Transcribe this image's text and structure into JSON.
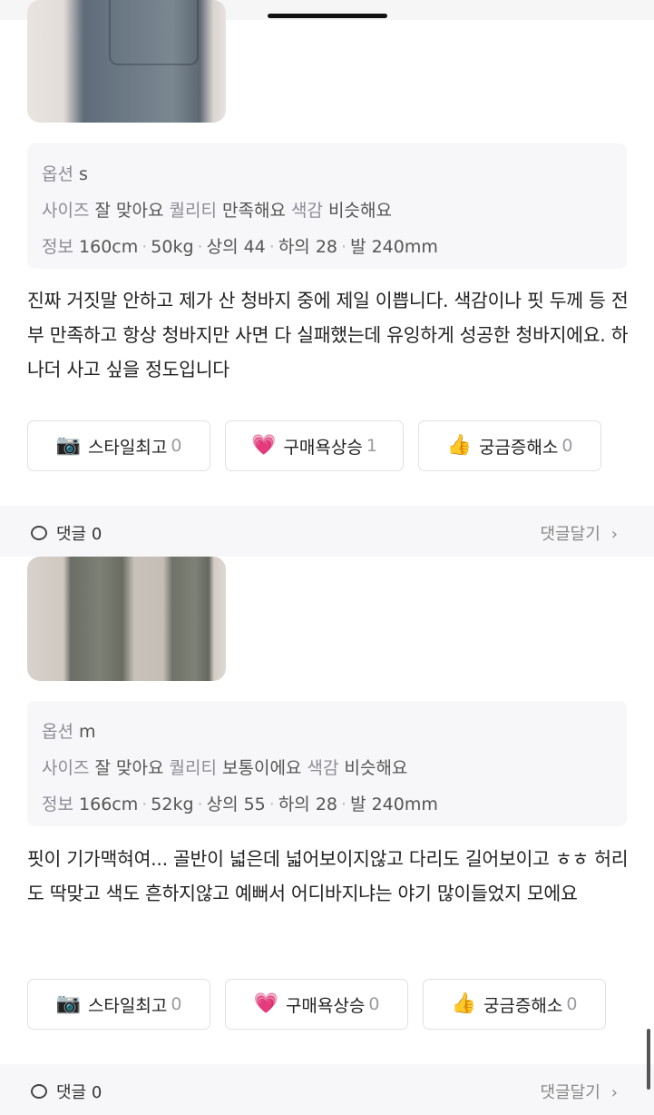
{
  "review1": {
    "option_label": "옵션",
    "option_value": "s",
    "attrs": [
      {
        "key": "사이즈",
        "value": "잘 맞아요"
      },
      {
        "key": "퀄리티",
        "value": "만족해요"
      },
      {
        "key": "색감",
        "value": "비슷해요"
      }
    ],
    "body_label": "정보",
    "body": [
      "160cm",
      "50kg",
      "상의 44",
      "하의 28",
      "발 240mm"
    ],
    "text": "진짜 거짓말 안하고 제가 산 청바지 중에 제일 이쁩니다. 색감이나 핏 두께 등 전부 만족하고 항상 청바지만 사면 다 실패했는데 유잉하게 성공한 청바지에요. 하나더 사고 싶을 정도입니다",
    "reactions": [
      {
        "emoji": "📷",
        "label": "스타일최고",
        "count": "0"
      },
      {
        "emoji": "💗",
        "label": "구매욕상승",
        "count": "1"
      },
      {
        "emoji": "👍",
        "label": "궁금증해소",
        "count": "0"
      }
    ],
    "comments_label": "댓글 0",
    "write_comment": "댓글달기"
  },
  "review2": {
    "option_label": "옵션",
    "option_value": "m",
    "attrs": [
      {
        "key": "사이즈",
        "value": "잘 맞아요"
      },
      {
        "key": "퀄리티",
        "value": "보통이에요"
      },
      {
        "key": "색감",
        "value": "비슷해요"
      }
    ],
    "body_label": "정보",
    "body": [
      "166cm",
      "52kg",
      "상의 55",
      "하의 28",
      "발 240mm"
    ],
    "text": "핏이 기가맥혀여... 골반이 넓은데 넓어보이지않고 다리도 길어보이고 ㅎㅎ 허리도 딱맞고 색도 흔하지않고 예뻐서 어디바지냐는 야기 많이들었지 모에요",
    "reactions": [
      {
        "emoji": "📷",
        "label": "스타일최고",
        "count": "0"
      },
      {
        "emoji": "💗",
        "label": "구매욕상승",
        "count": "0"
      },
      {
        "emoji": "👍",
        "label": "궁금증해소",
        "count": "0"
      }
    ],
    "comments_label": "댓글 0",
    "write_comment": "댓글달기"
  }
}
